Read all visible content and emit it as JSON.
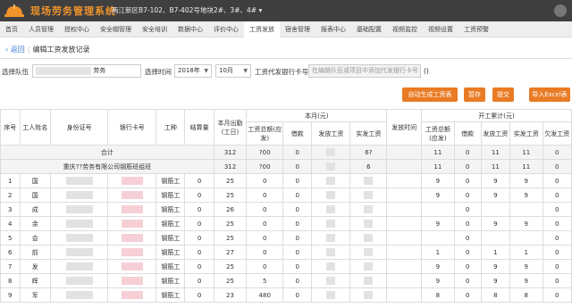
{
  "header": {
    "title": "现场劳务管理系统",
    "project": "两江新区B7-102、B7-402号地块2#、3#、4#",
    "project_caret": "▾"
  },
  "nav": [
    "首页",
    "人员管理",
    "授权中心",
    "安全帽管理",
    "安全培训",
    "数据中心",
    "评价中心",
    "工资发放",
    "宿舍管理",
    "报表中心",
    "基础配置",
    "视频监控",
    "视频设置",
    "工资预警"
  ],
  "breadcrumb": {
    "back": "返回",
    "title": "编辑工资发放记录"
  },
  "filters": {
    "team_label": "选择队伍",
    "team_value": "劳务",
    "period_label": "选择时间",
    "year": "2018年",
    "month": "10月",
    "card_label": "工资代发银行卡号:",
    "card_placeholder": "在编辑队伍或项目中添加代发银行卡号",
    "card_suffix": "()"
  },
  "buttons": {
    "generate": "自动生成工资表",
    "save": "暂存",
    "submit": "提交",
    "import": "导入Excel表"
  },
  "table": {
    "headers": {
      "index": "序号",
      "name": "工人姓名",
      "id_card": "身份证号",
      "bank_card": "银行卡号",
      "job": "工种",
      "piecework": "结算量",
      "days": "本月出勤(工日)",
      "this_month": "本月(元)",
      "paid_time": "发放时间",
      "cumulative": "开工累计(元)"
    },
    "sub_headers": {
      "month_total": "工资总额(应发)",
      "month_borrow": "借款",
      "month_paid": "发放工资",
      "month_actual": "实发工资",
      "cum_total": "工资总额(应发)",
      "cum_borrow": "借款",
      "cum_paid": "发放工资",
      "cum_actual": "实发工资",
      "cum_owed": "欠发工资"
    },
    "total_row": {
      "label": "合计",
      "days": "312",
      "mt": "?00",
      "mb": "0",
      "mp": "",
      "ma": "6?",
      "ct": "11",
      "cb": "0",
      "cp": "11",
      "ca": "11",
      "co": "0"
    },
    "group_row": {
      "label": "重庆??劳务有限公司钢筋班组班",
      "days": "312",
      "mt": "?00",
      "mb": "0",
      "ma": "6",
      "ct": "11",
      "cb": "0",
      "cp": "11",
      "ca": "11",
      "co": "0"
    },
    "rows": [
      {
        "no": "1",
        "name": "国",
        "job": "钢筋工",
        "piece": "0",
        "days": "25",
        "mt": "0",
        "mb": "0",
        "ct": "9",
        "cb": "0",
        "cp": "9",
        "ca": "9",
        "co": "0"
      },
      {
        "no": "2",
        "name": "国",
        "job": "钢筋工",
        "piece": "0",
        "days": "25",
        "mt": "0",
        "mb": "0",
        "ct": "9",
        "cb": "0",
        "cp": "9",
        "ca": "9",
        "co": "0"
      },
      {
        "no": "3",
        "name": "成",
        "job": "钢筋工",
        "piece": "0",
        "days": "26",
        "mt": "0",
        "mb": "0",
        "ct": "",
        "cb": "0",
        "cp": "",
        "ca": "",
        "co": "0"
      },
      {
        "no": "4",
        "name": "余",
        "job": "钢筋工",
        "piece": "0",
        "days": "25",
        "mt": "0",
        "mb": "0",
        "ct": "9",
        "cb": "0",
        "cp": "9",
        "ca": "9",
        "co": "0"
      },
      {
        "no": "5",
        "name": "会",
        "job": "钢筋工",
        "piece": "0",
        "days": "25",
        "mt": "0",
        "mb": "0",
        "ct": "",
        "cb": "0",
        "cp": "",
        "ca": "",
        "co": "0"
      },
      {
        "no": "6",
        "name": "前",
        "job": "钢筋工",
        "piece": "0",
        "days": "27",
        "mt": "0",
        "mb": "0",
        "ct": "1",
        "cb": "0",
        "cp": "1",
        "ca": "1",
        "co": "0"
      },
      {
        "no": "7",
        "name": "发",
        "job": "钢筋工",
        "piece": "0",
        "days": "25",
        "mt": "0",
        "mb": "0",
        "ct": "9",
        "cb": "0",
        "cp": "9",
        "ca": "9",
        "co": "0"
      },
      {
        "no": "8",
        "name": "辉",
        "job": "钢筋工",
        "piece": "0",
        "days": "25",
        "mt": "5",
        "mb": "0",
        "ct": "9",
        "cb": "0",
        "cp": "9",
        "ca": "9",
        "co": "0"
      },
      {
        "no": "9",
        "name": "军",
        "job": "钢筋工",
        "piece": "0",
        "days": "23",
        "mt": "480",
        "mb": "0",
        "ct": "8",
        "cb": "0",
        "cp": "8",
        "ca": "8",
        "co": "0"
      }
    ]
  },
  "colors": {
    "topbar": "#3f3f3f",
    "brand": "#f0932b",
    "button": "#e97b24",
    "link": "#3a7bd5"
  }
}
